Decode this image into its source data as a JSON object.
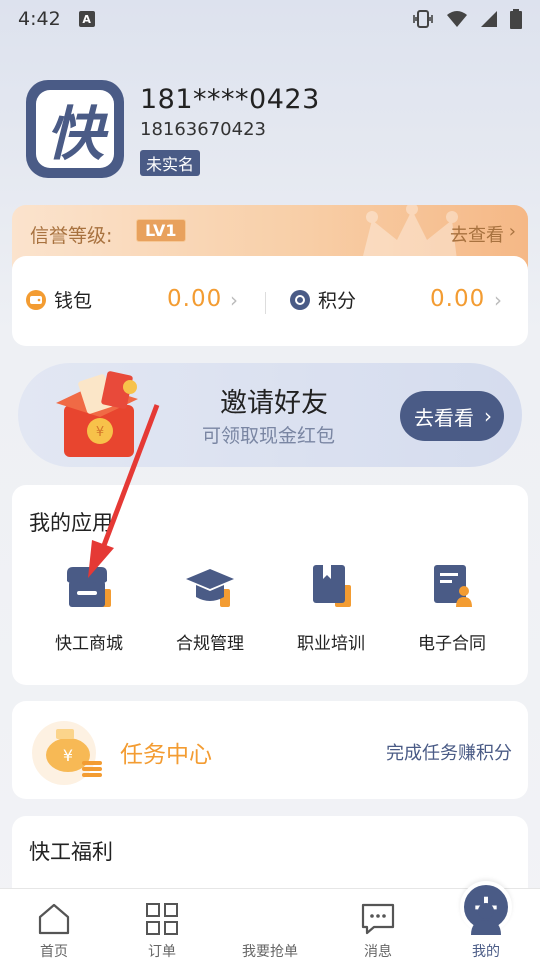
{
  "status_bar": {
    "time": "4:42",
    "notif": "A"
  },
  "profile": {
    "avatar_char": "快",
    "phone_masked": "181****0423",
    "phone_full": "18163670423",
    "verify_status": "未实名"
  },
  "credit": {
    "label": "信誉等级:",
    "level": "LV1",
    "link": "去查看"
  },
  "wallet": {
    "wallet_label": "钱包",
    "wallet_value": "0.00",
    "points_label": "积分",
    "points_value": "0.00"
  },
  "invite": {
    "title": "邀请好友",
    "subtitle": "可领取现金红包",
    "button": "去看看"
  },
  "apps": {
    "title": "我的应用",
    "items": [
      {
        "label": "快工商城",
        "icon": "store-icon"
      },
      {
        "label": "合规管理",
        "icon": "graduation-cap-icon"
      },
      {
        "label": "职业培训",
        "icon": "book-icon"
      },
      {
        "label": "电子合同",
        "icon": "contract-icon"
      }
    ]
  },
  "task": {
    "title": "任务中心",
    "desc": "完成任务赚积分"
  },
  "welfare": {
    "title": "快工福利"
  },
  "tabbar": {
    "items": [
      {
        "label": "首页",
        "icon": "home-icon"
      },
      {
        "label": "订单",
        "icon": "grid-icon"
      },
      {
        "label": "我要抢单",
        "icon": "plus-icon"
      },
      {
        "label": "消息",
        "icon": "chat-icon"
      },
      {
        "label": "我的",
        "icon": "user-icon"
      }
    ],
    "active": "我的"
  },
  "colors": {
    "primary": "#4a5b86",
    "accent": "#f39c32",
    "arrow": "#e53935"
  }
}
